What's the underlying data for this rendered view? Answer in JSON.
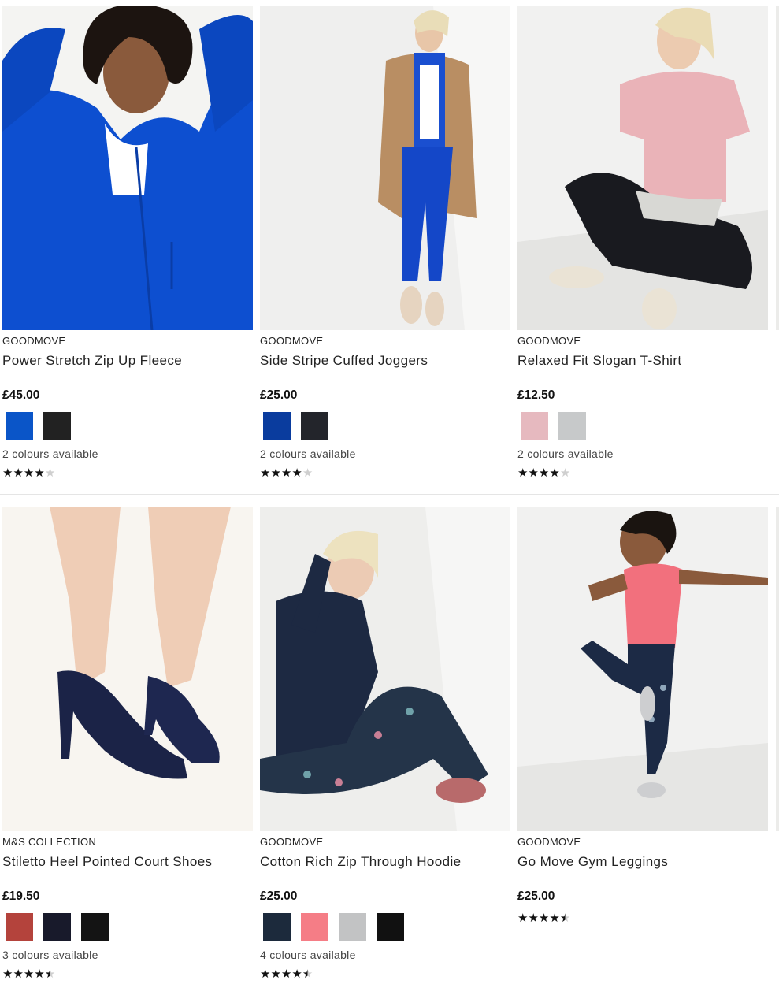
{
  "products": [
    {
      "brand": "GOODMOVE",
      "name": "Power Stretch Zip Up Fleece",
      "price": "£45.00",
      "swatches": [
        "#0a55c8",
        "#222222"
      ],
      "colours_text": "2 colours available",
      "rating": 4,
      "image": "woman-blue-fleece-photo"
    },
    {
      "brand": "GOODMOVE",
      "name": "Side Stripe Cuffed Joggers",
      "price": "£25.00",
      "swatches": [
        "#0a3c9e",
        "#23252b"
      ],
      "colours_text": "2 colours available",
      "rating": 4,
      "image": "woman-blue-joggers-photo"
    },
    {
      "brand": "GOODMOVE",
      "name": "Relaxed Fit Slogan T-Shirt",
      "price": "£12.50",
      "swatches": [
        "#e6b9bf",
        "#c7c9ca"
      ],
      "colours_text": "2 colours available",
      "rating": 4,
      "image": "woman-pink-tshirt-photo"
    },
    {
      "brand": "M&S COLLECTION",
      "name": "Stiletto Heel Pointed Court Shoes",
      "price": "£19.50",
      "swatches": [
        "#b4433c",
        "#181a2b",
        "#141414"
      ],
      "colours_text": "3 colours available",
      "rating": 4.5,
      "image": "navy-court-shoes-photo"
    },
    {
      "brand": "GOODMOVE",
      "name": "Cotton Rich Zip Through Hoodie",
      "price": "£25.00",
      "swatches": [
        "#1c2a3c",
        "#f57d86",
        "#c2c3c4",
        "#111111"
      ],
      "colours_text": "4 colours available",
      "rating": 4.5,
      "image": "woman-navy-hoodie-photo"
    },
    {
      "brand": "GOODMOVE",
      "name": "Go Move Gym Leggings",
      "price": "£25.00",
      "swatches": [],
      "colours_text": "",
      "rating": 4.5,
      "image": "woman-printed-leggings-photo"
    }
  ]
}
